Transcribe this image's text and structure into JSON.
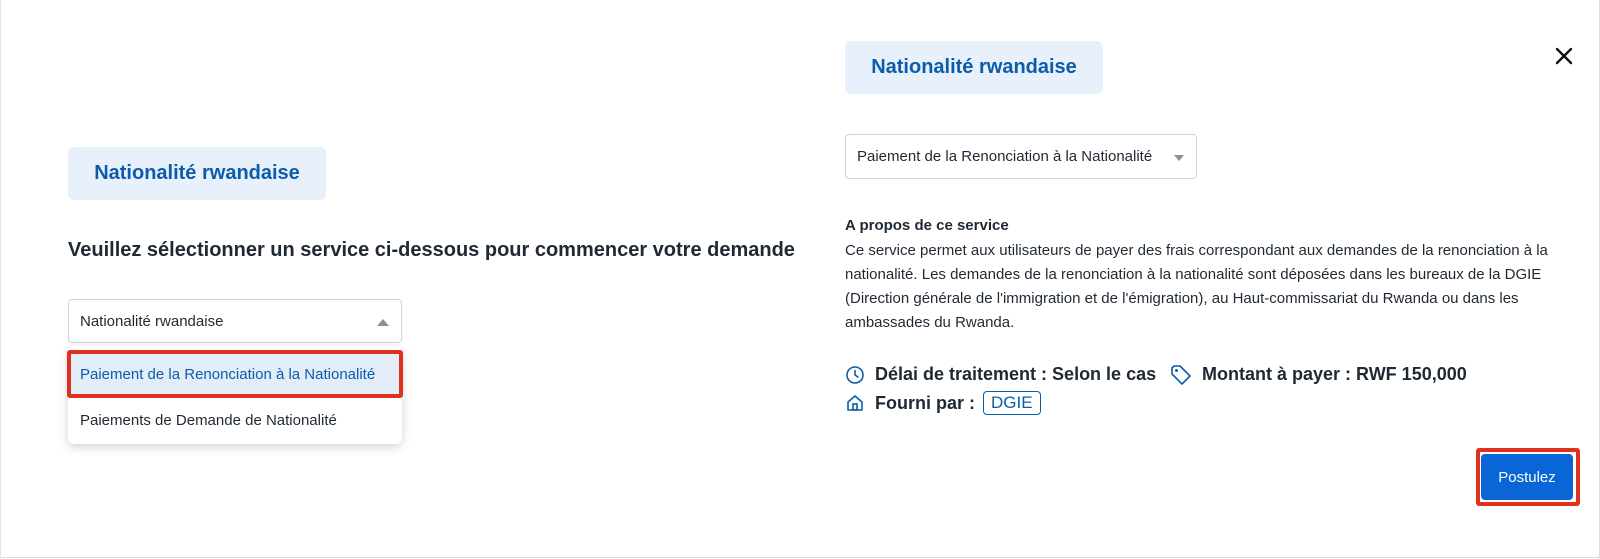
{
  "left_panel": {
    "category_chip": "Nationalité rwandaise",
    "prompt": "Veuillez sélectionner un service ci-dessous pour commencer votre demande",
    "select_value": "Nationalité rwandaise",
    "options": [
      "Paiement de la Renonciation à la Nationalité",
      "Paiements de Demande de Nationalité"
    ]
  },
  "right_panel": {
    "category_chip": "Nationalité rwandaise",
    "service_select_value": "Paiement de la Renonciation à la Nationalité",
    "about_title": "A propos de ce service",
    "about_text": "Ce service permet aux utilisateurs de payer des frais correspondant aux demandes de la renonciation à la nationalité. Les demandes de la renonciation à la nationalité sont déposées dans les bureaux de la DGIE (Direction générale de l'immigration et de l'émigration), au Haut-commissariat du Rwanda ou dans les ambassades du Rwanda.",
    "processing_time": "Délai de traitement : Selon le cas",
    "amount": "Montant à payer : RWF 150,000",
    "provided_by_label": "Fourni par :",
    "provider": "DGIE",
    "apply_label": "Postulez"
  },
  "icons": {
    "close": "close-icon",
    "clock": "clock-icon",
    "tag": "price-tag-icon",
    "home": "home-icon"
  },
  "colors": {
    "accent": "#0a66d6",
    "chip_bg": "#e8f1fb",
    "highlight": "#e0301e"
  }
}
